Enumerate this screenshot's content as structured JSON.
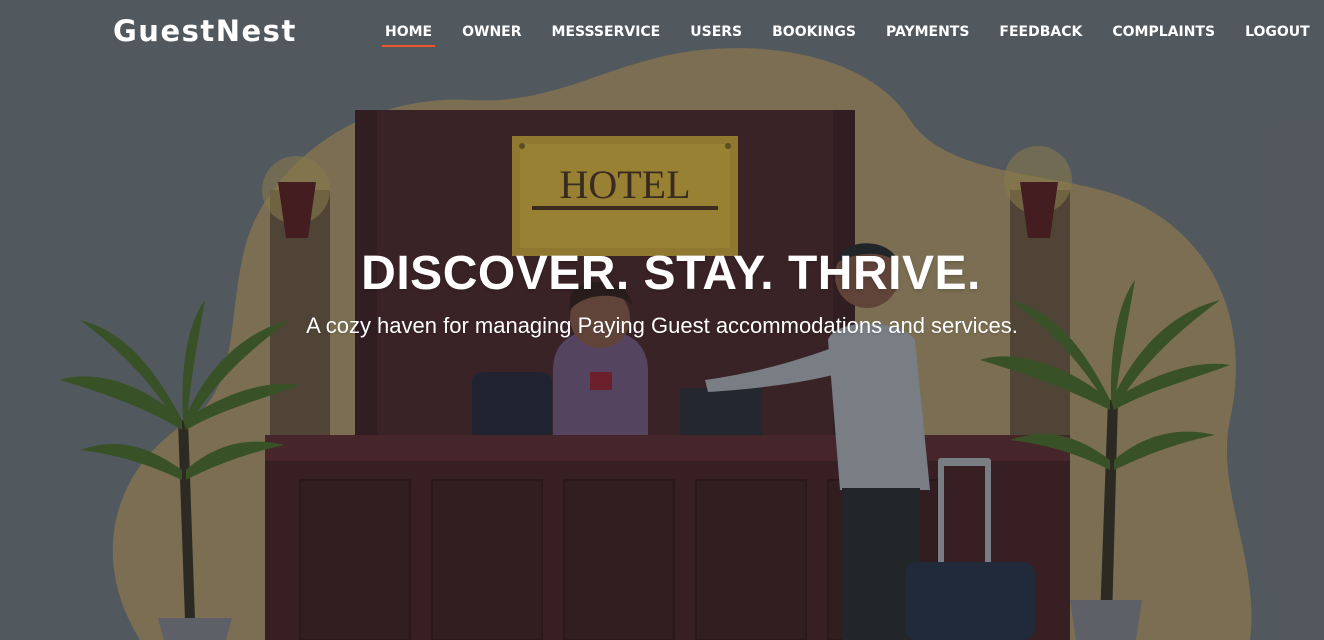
{
  "brand": {
    "name": "GuestNest"
  },
  "nav": {
    "active_index": 0,
    "items": [
      {
        "label": "HOME"
      },
      {
        "label": "OWNER"
      },
      {
        "label": "MESSSERVICE"
      },
      {
        "label": "USERS"
      },
      {
        "label": "BOOKINGS"
      },
      {
        "label": "PAYMENTS"
      },
      {
        "label": "FEEDBACK"
      },
      {
        "label": "COMPLAINTS"
      },
      {
        "label": "LOGOUT"
      }
    ]
  },
  "hero": {
    "title": "DISCOVER. STAY. THRIVE.",
    "subtitle": "A cozy haven for managing Paying Guest accommodations and services.",
    "sign_text": "HOTEL"
  },
  "colors": {
    "background": "#5b6268",
    "accent": "#e8562c",
    "nav_text": "#ffffff"
  }
}
